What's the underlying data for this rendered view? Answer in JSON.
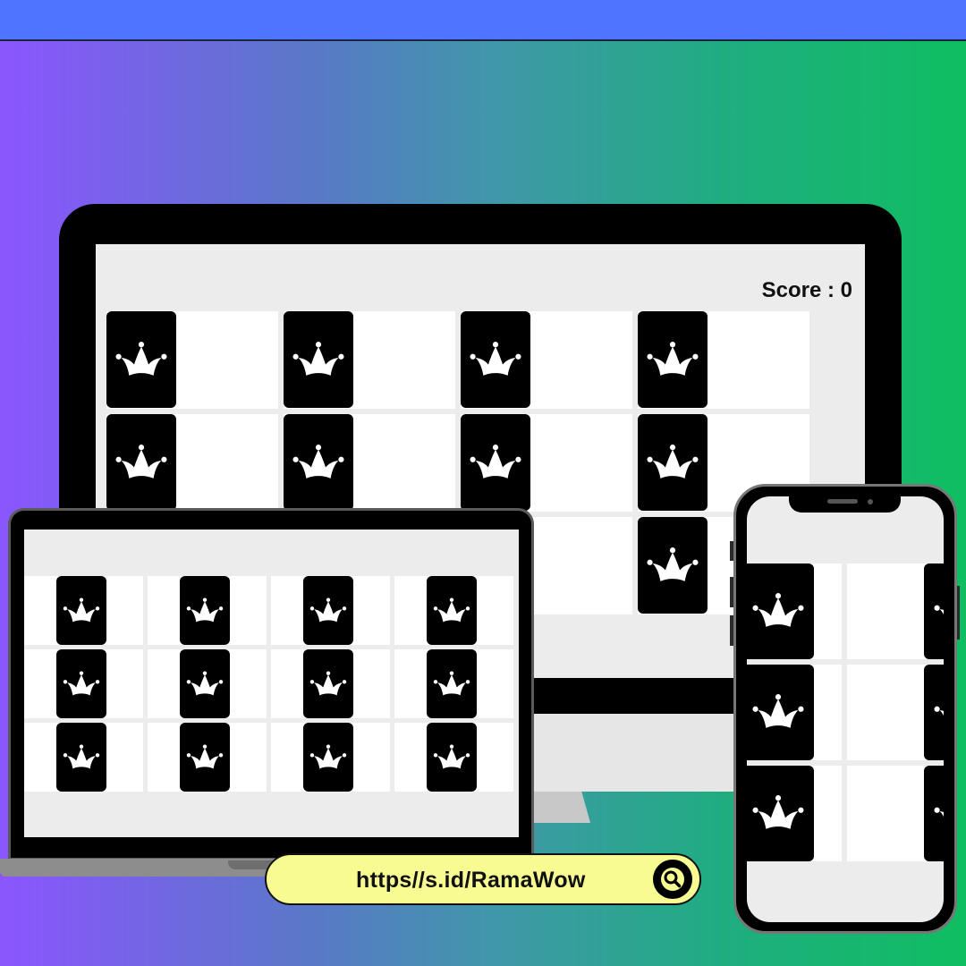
{
  "game": {
    "score_text": "Score : 0",
    "card_back_icon": "jester-crown-icon"
  },
  "desktop": {
    "rows": 3,
    "cols": 4,
    "visible_cards": 12
  },
  "laptop": {
    "rows": 3,
    "cols": 4,
    "visible_cards": 12
  },
  "phone": {
    "rows": 3,
    "cols": 2,
    "visible_cards": 6
  },
  "url_bar": {
    "text": "https//s.id/RamaWow",
    "icon": "search-icon",
    "background": "#f7fb92"
  },
  "colors": {
    "card_back": "#000000",
    "cell_background": "#ffffff",
    "screen_background": "#ececec",
    "top_bar": "#4f74ff"
  }
}
